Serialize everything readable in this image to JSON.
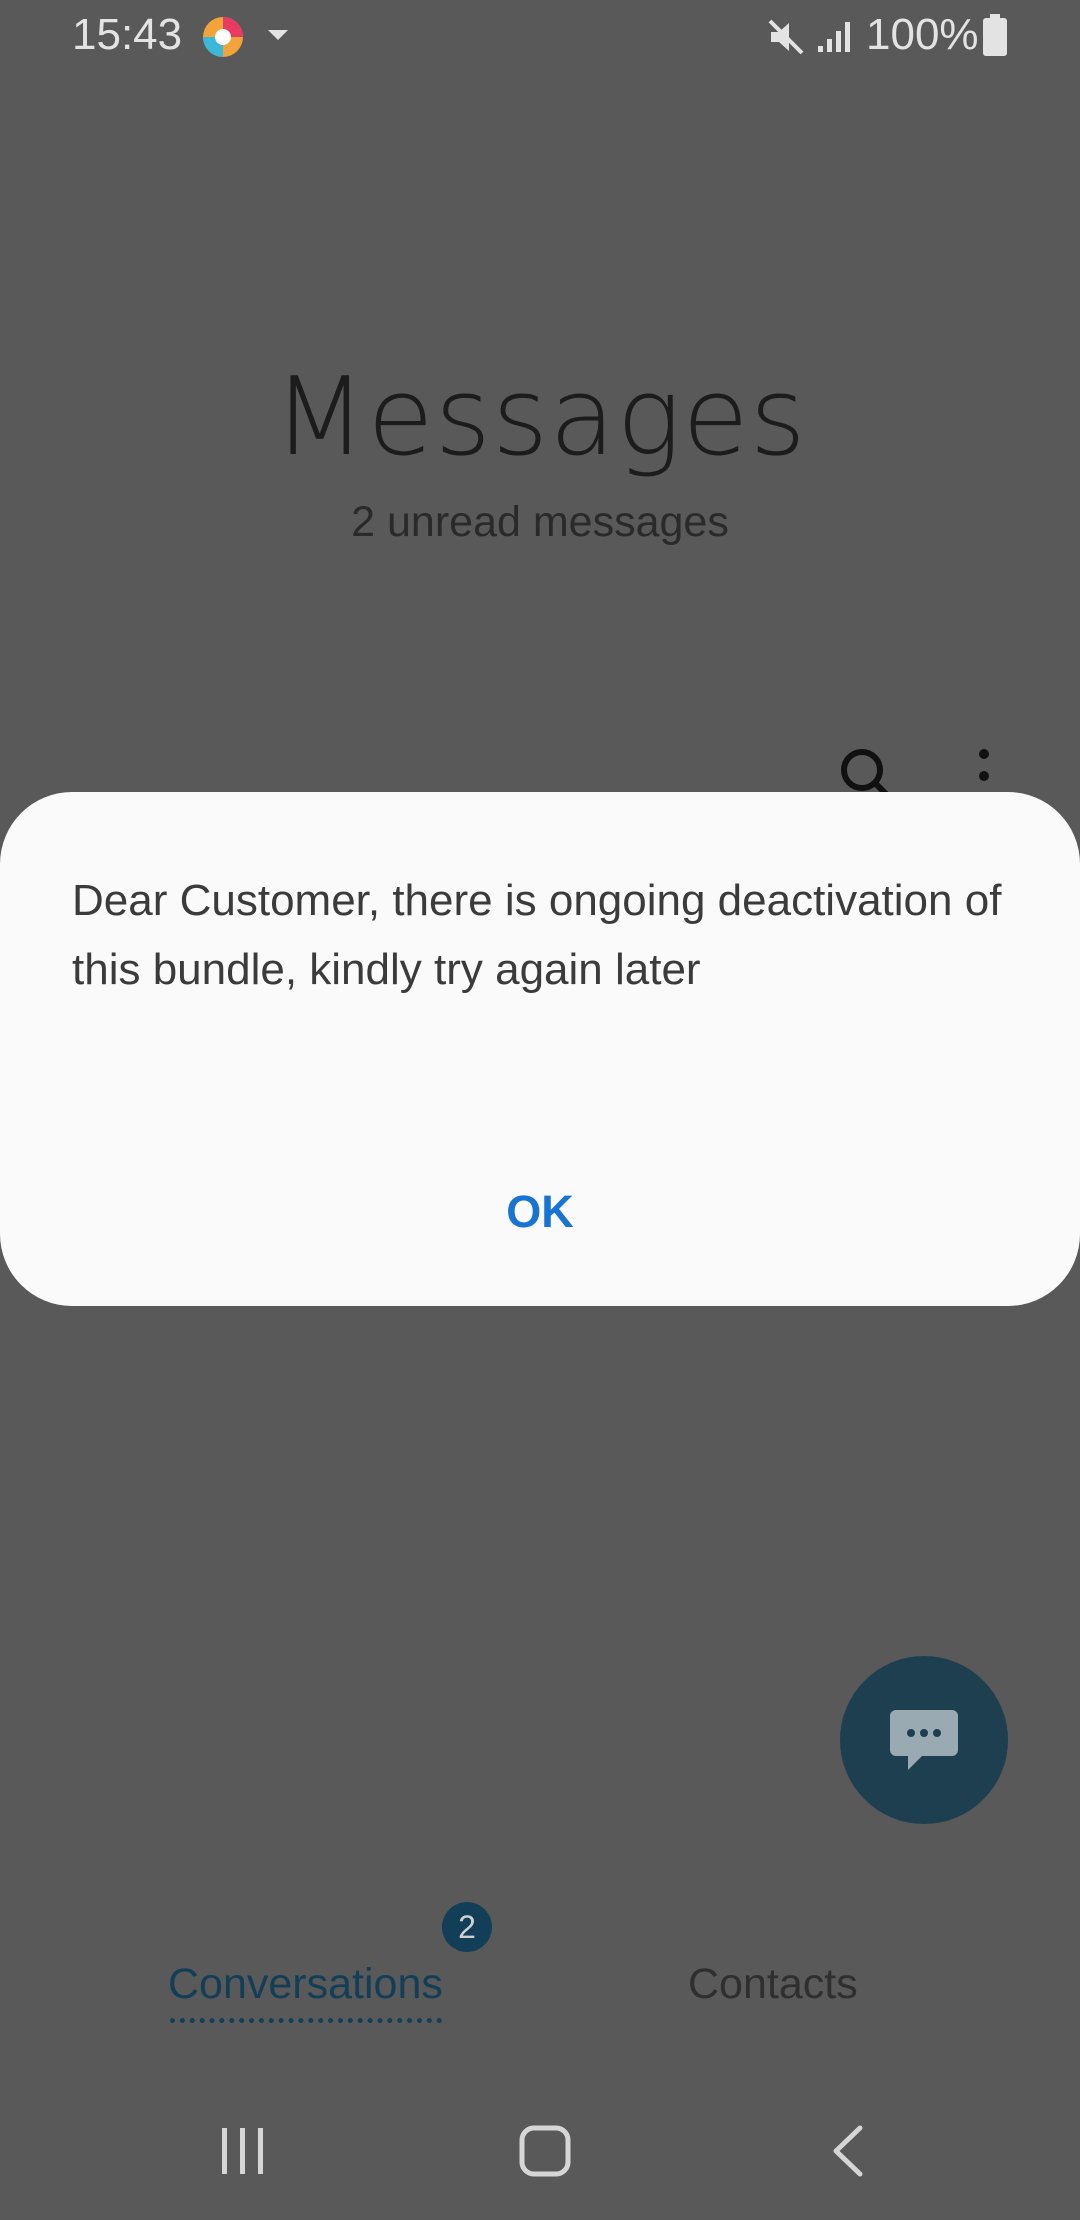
{
  "status_bar": {
    "time": "15:43",
    "battery_percent": "100%",
    "icons": [
      "app-notification-icon",
      "dropdown-arrow-icon",
      "mute-icon",
      "signal-icon",
      "battery-icon"
    ]
  },
  "header": {
    "title": "Messages",
    "subtitle": "2 unread messages",
    "icons": [
      "search-icon",
      "more-options-icon"
    ]
  },
  "dialog": {
    "message": "Dear Customer, there is ongoing deactivation of this bundle, kindly try again later",
    "ok_label": "OK"
  },
  "fab": {
    "icon": "compose-message-icon"
  },
  "tabs": [
    {
      "label": "Conversations",
      "badge": "2",
      "active": true
    },
    {
      "label": "Contacts",
      "active": false
    }
  ],
  "nav_bar": {
    "icons": [
      "recents-icon",
      "home-icon",
      "back-icon"
    ]
  },
  "colors": {
    "scrim_background": "#595959",
    "dialog_background": "#fafafa",
    "accent_blue": "#1774d2",
    "tab_active": "#123f57",
    "fab_background": "#1d3f50"
  }
}
